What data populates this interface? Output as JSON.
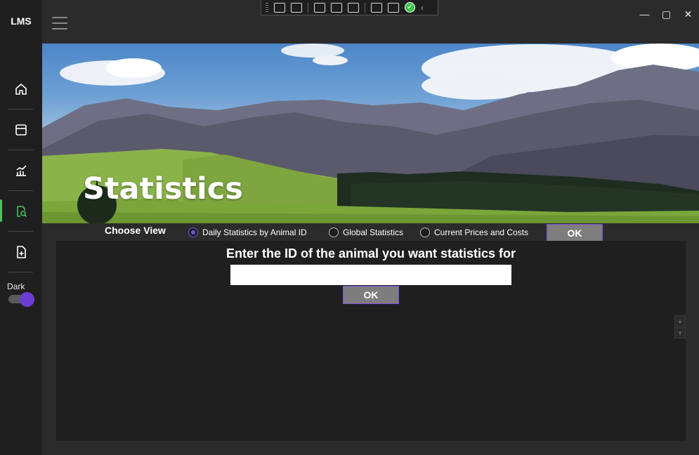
{
  "app": {
    "title": "LMS"
  },
  "sidebar": {
    "items": [
      {
        "icon": "home-icon",
        "label": "Home"
      },
      {
        "icon": "panel-icon",
        "label": "Dashboard"
      },
      {
        "icon": "chart-icon",
        "label": "Reports"
      },
      {
        "icon": "search-document-icon",
        "label": "Statistics",
        "active": true
      },
      {
        "icon": "add-document-icon",
        "label": "Add"
      }
    ],
    "theme_label": "Dark",
    "theme_toggle_on": true
  },
  "window_controls": {
    "minimize": "—",
    "maximize": "▢",
    "close": "✕"
  },
  "debug_toolbar": {
    "check": "✓",
    "collapse": "‹"
  },
  "hero": {
    "title": "Statistics"
  },
  "view_selector": {
    "label": "Choose View",
    "options": [
      {
        "label": "Daily Statistics by Animal ID",
        "checked": true
      },
      {
        "label": "Global Statistics",
        "checked": false
      },
      {
        "label": "Current Prices and Costs",
        "checked": false
      }
    ],
    "ok_label": "OK"
  },
  "panel": {
    "prompt": "Enter the ID of the animal you want statistics for",
    "input_value": "",
    "ok_label": "OK"
  },
  "scroll": {
    "up": "▲",
    "down": "▼"
  },
  "colors": {
    "accent": "#7a52e0",
    "active_nav": "#47c35a",
    "background": "#2b2b2b"
  }
}
